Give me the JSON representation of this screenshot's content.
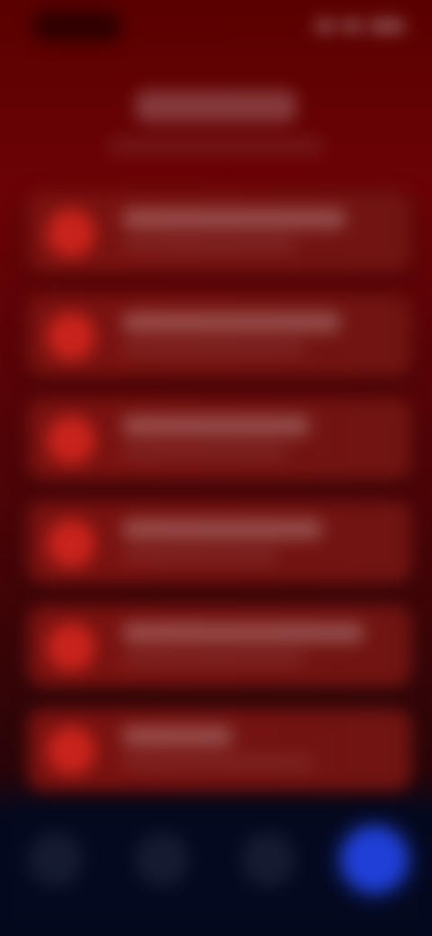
{
  "status_bar": {
    "time": "",
    "icons": [
      "signal-icon",
      "wifi-icon",
      "battery-icon"
    ]
  },
  "header": {
    "title": "",
    "subtitle": ""
  },
  "cards": [
    {
      "title": "",
      "subtitle": "",
      "icon": "red-circle-icon"
    },
    {
      "title": "",
      "subtitle": "",
      "icon": "red-circle-icon"
    },
    {
      "title": "",
      "subtitle": "",
      "icon": "red-circle-icon"
    },
    {
      "title": "",
      "subtitle": "",
      "icon": "red-circle-icon"
    },
    {
      "title": "",
      "subtitle": "",
      "icon": "red-circle-icon"
    },
    {
      "title": "",
      "subtitle": "",
      "icon": "red-circle-icon"
    }
  ],
  "tab_bar": {
    "tabs": [
      {
        "icon": "tab-icon-1",
        "active": false
      },
      {
        "icon": "tab-icon-2",
        "active": false
      },
      {
        "icon": "tab-icon-3",
        "active": false
      },
      {
        "icon": "tab-icon-4",
        "active": true
      }
    ]
  },
  "colors": {
    "background_top": "#5a0000",
    "card": "#7a1210",
    "card_icon": "#c9231b",
    "tab_bar": "#04091f",
    "tab_active": "#1f3fd6"
  }
}
